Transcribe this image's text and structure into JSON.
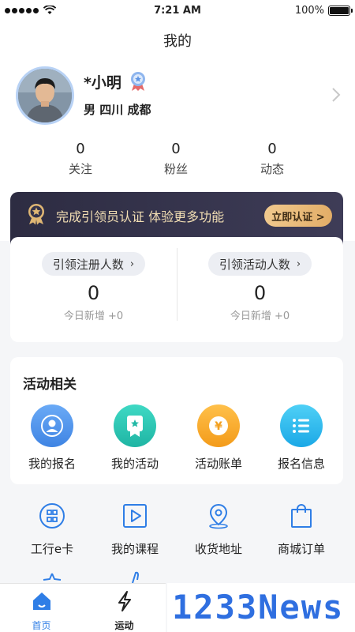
{
  "status_bar": {
    "time": "7:21 AM",
    "battery": "100%"
  },
  "nav": {
    "title": "我的"
  },
  "profile": {
    "name": "*小明",
    "location": "男  四川 成都"
  },
  "stats": [
    {
      "value": "0",
      "label": "关注"
    },
    {
      "value": "0",
      "label": "粉丝"
    },
    {
      "value": "0",
      "label": "动态"
    }
  ],
  "banner": {
    "text": "完成引领员认证 体验更多功能",
    "button": "立即认证 >"
  },
  "referral": [
    {
      "label": "引领注册人数",
      "value": "0",
      "sub": "今日新增 +0"
    },
    {
      "label": "引领活动人数",
      "value": "0",
      "sub": "今日新增 +0"
    }
  ],
  "activities": {
    "title": "活动相关",
    "items": [
      {
        "label": "我的报名",
        "color": "#4a90e8"
      },
      {
        "label": "我的活动",
        "color": "#2ac2b0"
      },
      {
        "label": "活动账单",
        "color": "#f5a524"
      },
      {
        "label": "报名信息",
        "color": "#2fb5ec"
      }
    ]
  },
  "tools": [
    {
      "label": "工行e卡"
    },
    {
      "label": "我的课程"
    },
    {
      "label": "收货地址"
    },
    {
      "label": "商城订单"
    }
  ],
  "tabbar": [
    {
      "label": "首页",
      "active": true
    },
    {
      "label": "运动",
      "active": false
    }
  ],
  "watermark": "1233News",
  "colors": {
    "accent": "#2f7ee6",
    "banner_bg": "#2d2c42",
    "banner_button": "#e9bb7a"
  }
}
